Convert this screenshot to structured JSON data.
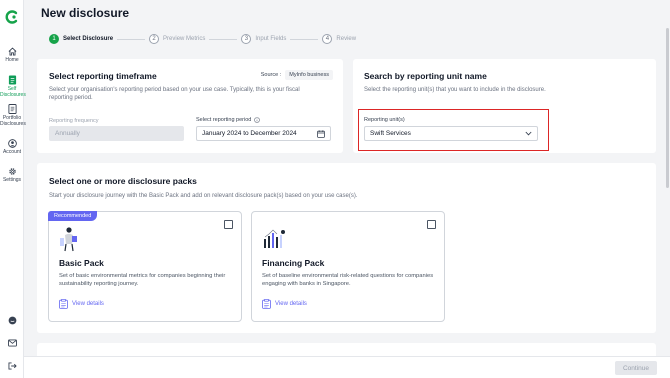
{
  "sidebar": {
    "items": [
      {
        "label": "Home",
        "icon": "home-icon"
      },
      {
        "label": "Self Disclosures",
        "icon": "document-icon",
        "active": true
      },
      {
        "label": "Portfolio Disclosures",
        "icon": "portfolio-icon"
      },
      {
        "label": "Account",
        "icon": "account-icon"
      },
      {
        "label": "Settings",
        "icon": "gear-icon"
      }
    ],
    "bottom_icons": [
      "chat-icon",
      "mail-icon",
      "logout-icon"
    ],
    "accent": "#0f9d58"
  },
  "page": {
    "title": "New disclosure"
  },
  "stepper": {
    "steps": [
      {
        "num": "1",
        "label": "Select Disclosure",
        "active": true
      },
      {
        "num": "2",
        "label": "Preview Metrics"
      },
      {
        "num": "3",
        "label": "Input Fields"
      },
      {
        "num": "4",
        "label": "Review"
      }
    ]
  },
  "timeframe": {
    "title": "Select reporting timeframe",
    "source_label": "Source :",
    "source_value": "MyInfo business",
    "description": "Select your organisation's reporting period based on your use case. Typically, this is your fiscal reporting period.",
    "frequency_label": "Reporting frequency",
    "frequency_value": "Annually",
    "period_label": "Select reporting period",
    "period_value": "January 2024 to December 2024"
  },
  "reporting_unit": {
    "title": "Search by reporting unit name",
    "description": "Select the reporting unit(s) that you want to include in the disclosure.",
    "field_label": "Reporting unit(s)",
    "field_value": "Swift Services"
  },
  "packs": {
    "title": "Select one or more disclosure packs",
    "description": "Start your disclosure journey with the Basic Pack and add on relevant disclosure pack(s) based on your use case(s).",
    "items": [
      {
        "badge": "Recommended",
        "title": "Basic Pack",
        "description": "Set of basic environmental metrics for companies beginning their sustainability reporting journey.",
        "link": "View details"
      },
      {
        "title": "Financing Pack",
        "description": "Set of baseline environmental risk-related questions for companies engaging with banks in Singapore.",
        "link": "View details"
      }
    ]
  },
  "footer": {
    "continue_label": "Continue"
  },
  "colors": {
    "step_active": "#16a34a",
    "link": "#6366f1",
    "highlight": "#dc2626"
  }
}
